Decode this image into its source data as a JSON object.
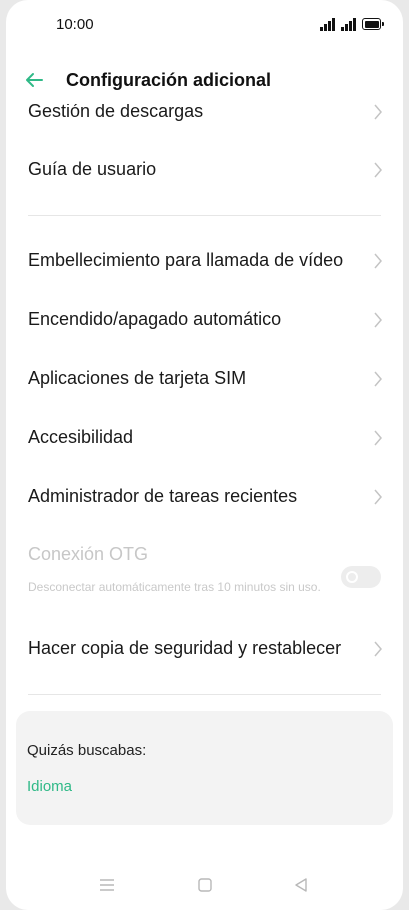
{
  "status_bar": {
    "time": "10:00"
  },
  "header": {
    "title": "Configuración adicional"
  },
  "list": {
    "partial_item": "Gestión de descargas",
    "user_guide": "Guía de usuario",
    "video_call_beauty": "Embellecimiento para llamada de vídeo",
    "auto_power": "Encendido/apagado automático",
    "sim_apps": "Aplicaciones de tarjeta SIM",
    "accessibility": "Accesibilidad",
    "recent_tasks": "Administrador de tareas recientes",
    "otg": {
      "label": "Conexión OTG",
      "description": "Desconectar automáticamente tras 10 minutos sin uso.",
      "enabled": false
    },
    "backup_reset": "Hacer copia de seguridad y restablecer"
  },
  "suggestions": {
    "title": "Quizás buscabas:",
    "link": "Idioma"
  },
  "colors": {
    "accent": "#2fb987",
    "text": "#1a1a1a",
    "disabled": "#c7c7c7"
  },
  "icons": {
    "back": "arrow-left-icon",
    "chevron": "chevron-right-icon",
    "nav_menu": "menu-icon",
    "nav_home": "home-icon",
    "nav_back": "triangle-back-icon"
  }
}
